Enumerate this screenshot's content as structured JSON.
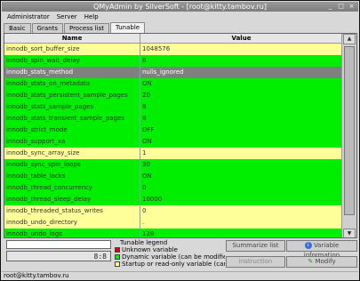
{
  "window": {
    "title": "QMyAdmin by SilverSoft - [root@kitty.tambov.ru]",
    "controls": [
      "_",
      "□",
      "×"
    ]
  },
  "menu": [
    "Administrator",
    "Server",
    "Help"
  ],
  "tabs": [
    {
      "label": "Basic",
      "active": false
    },
    {
      "label": "Grants",
      "active": false
    },
    {
      "label": "Process list",
      "active": false
    },
    {
      "label": "Tunable",
      "active": true
    }
  ],
  "table": {
    "columns": [
      "Name",
      "Value"
    ],
    "rows": [
      {
        "name": "innodb_sort_buffer_size",
        "value": "1048576",
        "color": "#ffff99"
      },
      {
        "name": "innodb_spin_wait_delay",
        "value": "6",
        "color": "#00ee00"
      },
      {
        "name": "innodb_stats_method",
        "value": "nulls_ignored",
        "color": "#808080"
      },
      {
        "name": "innodb_stats_on_metadata",
        "value": "ON",
        "color": "#00ee00"
      },
      {
        "name": "innodb_stats_persistent_sample_pages",
        "value": "20",
        "color": "#00ee00"
      },
      {
        "name": "innodb_stats_sample_pages",
        "value": "8",
        "color": "#00ee00"
      },
      {
        "name": "innodb_stats_transient_sample_pages",
        "value": "8",
        "color": "#00ee00"
      },
      {
        "name": "innodb_strict_mode",
        "value": "OFF",
        "color": "#00ee00"
      },
      {
        "name": "innodb_support_xa",
        "value": "ON",
        "color": "#00ee00"
      },
      {
        "name": "innodb_sync_array_size",
        "value": "1",
        "color": "#ffff99"
      },
      {
        "name": "innodb_sync_spin_loops",
        "value": "30",
        "color": "#00ee00"
      },
      {
        "name": "innodb_table_locks",
        "value": "ON",
        "color": "#00ee00"
      },
      {
        "name": "innodb_thread_concurrency",
        "value": "0",
        "color": "#00ee00"
      },
      {
        "name": "innodb_thread_sleep_delay",
        "value": "10000",
        "color": "#00ee00"
      },
      {
        "name": "innodb_threaded_status_writes",
        "value": "0",
        "color": "#ffff99"
      },
      {
        "name": "innodb_undo_directory",
        "value": ".",
        "color": "#ffff99"
      },
      {
        "name": "innodb_undo_logs",
        "value": "128",
        "color": "#00ee00"
      }
    ]
  },
  "search": {
    "value": ""
  },
  "lcd": "8:8",
  "legend": {
    "title": "Tunable legend",
    "items": [
      {
        "label": "Unknown variable",
        "color": "#e00000"
      },
      {
        "label": "Dynamic variable (can be modified)",
        "color": "#00ee00"
      },
      {
        "label": "Startup or read-only variable (cannot be modified)",
        "color": "#ffff99"
      }
    ]
  },
  "buttons": {
    "summarize": "Summarize list",
    "info": "Variable information",
    "instruction": "Instruction",
    "modify": "Modify"
  },
  "status": "root@kitty.tambov.ru"
}
